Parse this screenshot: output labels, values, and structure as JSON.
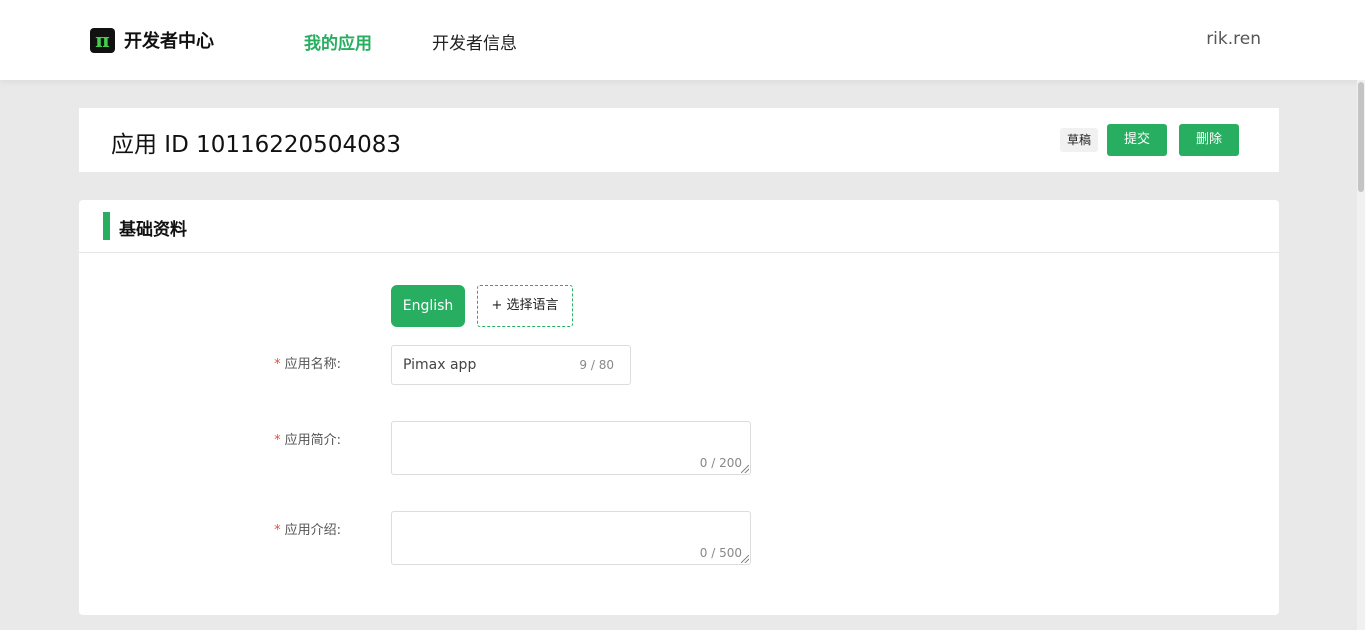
{
  "header": {
    "logo_glyph": "π",
    "logo_text": "开发者中心",
    "nav": [
      {
        "label": "我的应用",
        "active": true
      },
      {
        "label": "开发者信息",
        "active": false
      }
    ],
    "user": "rik.ren"
  },
  "app_header": {
    "title": "应用 ID 10116220504083",
    "status_badge": "草稿",
    "submit_label": "提交",
    "delete_label": "删除"
  },
  "section": {
    "title": "基础资料",
    "languages": {
      "active": "English",
      "add_label": "+ 选择语言"
    },
    "fields": {
      "name": {
        "required_mark": "*",
        "label": "应用名称:",
        "value": "Pimax app",
        "counter": "9 / 80"
      },
      "summary": {
        "required_mark": "*",
        "label": "应用简介:",
        "value": "",
        "counter": "0 / 200"
      },
      "description": {
        "required_mark": "*",
        "label": "应用介绍:",
        "value": "",
        "counter": "0 / 500"
      }
    }
  },
  "colors": {
    "accent": "#27ae60",
    "required": "#e74c3c",
    "page_bg": "#e9e9e9"
  }
}
